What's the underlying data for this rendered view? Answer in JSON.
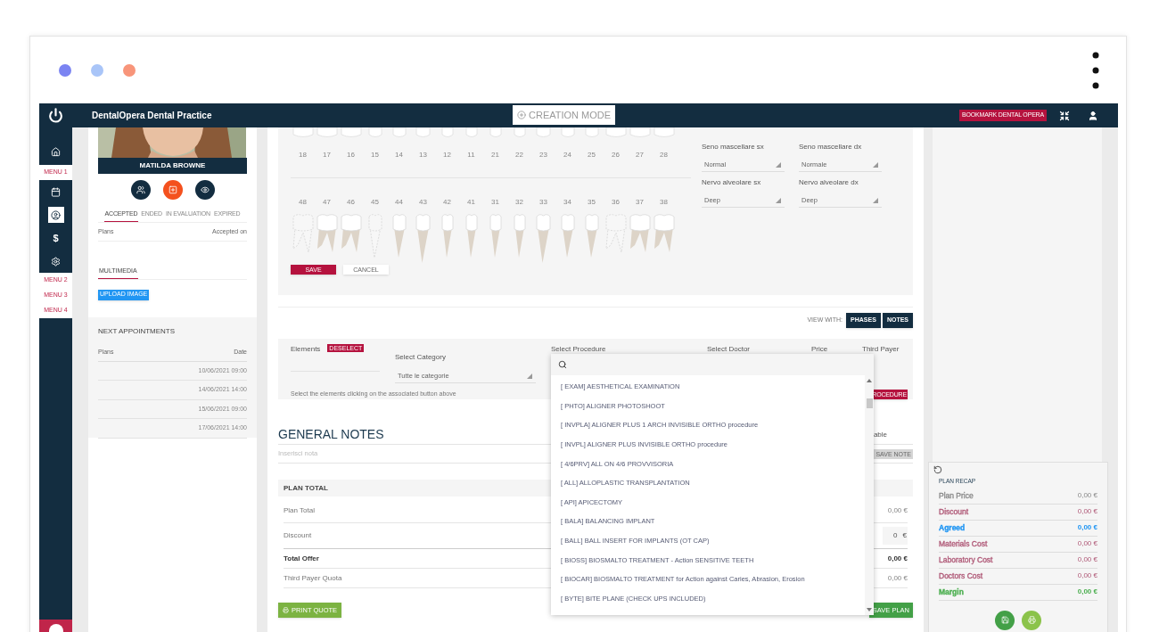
{
  "header": {
    "title": "DentalOpera Dental Practice",
    "mode": "CREATION MODE",
    "bookmark": "BOOKMARK DENTAL OPERA"
  },
  "sidebar": {
    "items": [
      {
        "kind": "icon",
        "selected": false
      },
      {
        "kind": "menu",
        "label": "MENU 1"
      },
      {
        "kind": "icon",
        "selected": false
      },
      {
        "kind": "icon",
        "selected": true
      },
      {
        "kind": "symbol",
        "label": "$",
        "selected": false
      },
      {
        "kind": "icon",
        "selected": false
      },
      {
        "kind": "menu",
        "label": "MENU 2"
      },
      {
        "kind": "menu",
        "label": "MENU 3"
      },
      {
        "kind": "menu",
        "label": "MENU 4"
      }
    ]
  },
  "patient": {
    "name": "MATILDA BROWNE",
    "plan_tabs": [
      {
        "label": "ACCEPTED",
        "selected": true
      },
      {
        "label": "ENDED",
        "selected": false
      },
      {
        "label": "IN EVALUATION",
        "selected": false
      },
      {
        "label": "EXPIRED",
        "selected": false
      }
    ],
    "plan_columns": [
      "Plans",
      "Accepted on"
    ],
    "media_tabs": [
      {
        "label": "MULTIMEDIA",
        "selected": true
      }
    ],
    "upload_button": "UPLOAD IMAGE"
  },
  "appointments": {
    "title": "NEXT APPOINTMENTS",
    "columns": [
      "Plans",
      "Date"
    ],
    "rows": [
      "10/06/2021 09:00",
      "14/06/2021 14:00",
      "15/06/2021 09:00",
      "17/06/2021 14:00"
    ]
  },
  "odontogram": {
    "upper": [
      {
        "number": "18"
      },
      {
        "number": "17"
      },
      {
        "number": "16"
      },
      {
        "number": "15"
      },
      {
        "number": "14"
      },
      {
        "number": "13"
      },
      {
        "number": "12"
      },
      {
        "number": "11"
      },
      {
        "number": "21"
      },
      {
        "number": "22"
      },
      {
        "number": "23"
      },
      {
        "number": "24"
      },
      {
        "number": "25"
      },
      {
        "number": "26"
      },
      {
        "number": "27"
      },
      {
        "number": "28"
      }
    ],
    "lower": [
      {
        "number": "48",
        "present": false
      },
      {
        "number": "47",
        "present": true
      },
      {
        "number": "46",
        "present": true
      },
      {
        "number": "45",
        "present": false
      },
      {
        "number": "44",
        "present": true
      },
      {
        "number": "43",
        "present": true
      },
      {
        "number": "42",
        "present": true
      },
      {
        "number": "41",
        "present": true
      },
      {
        "number": "31",
        "present": true
      },
      {
        "number": "32",
        "present": true
      },
      {
        "number": "33",
        "present": true
      },
      {
        "number": "34",
        "present": true
      },
      {
        "number": "35",
        "present": true
      },
      {
        "number": "36",
        "present": false
      },
      {
        "number": "37",
        "present": true
      },
      {
        "number": "38",
        "present": true
      }
    ],
    "fields": [
      {
        "label": "Seno mascellare sx",
        "value": "Normal"
      },
      {
        "label": "Seno mascellare dx",
        "value": "Normale"
      },
      {
        "label": "Nervo alveolare sx",
        "value": "Deep"
      },
      {
        "label": "Nervo alveolare dx",
        "value": "Deep"
      }
    ],
    "save": "SAVE",
    "cancel": "CANCEL"
  },
  "view_with": {
    "label": "VIEW WITH:",
    "buttons": [
      "PHASES",
      "NOTES"
    ]
  },
  "procedure_form": {
    "elements": "Elements",
    "deselect": "DESELECT",
    "category_label": "Select Category",
    "category_value": "Tutte le categorie",
    "procedure_label": "Select Procedure",
    "doctor_label": "Select Doctor",
    "price_label": "Price",
    "third_payer_label": "Third Payer",
    "hint": "Select the elements clicking on the associated button above",
    "add_button": "ROCEDURE"
  },
  "procedure_dropdown": {
    "items": [
      "[ EXAM] AESTHETICAL EXAMINATION",
      "[ PHTO] ALIGNER PHOTOSHOOT",
      "[ INVPLA] ALIGNER PLUS 1 ARCH INVISIBLE ORTHO procedure",
      "[ INVPL] ALIGNER PLUS INVISIBLE ORTHO procedure",
      "[ 4/6PRV] ALL ON 4/6 PROVVISORIA",
      "[ ALL] ALLOPLASTIC TRANSPLANTATION",
      "[ API] APICECTOMY",
      "[ BALA] BALANCING IMPLANT",
      "[ BALL] BALL INSERT FOR IMPLANTS (OT CAP)",
      "[ BIOSS] BIOSMALTO TREATMENT - Action SENSITIVE TEETH",
      "[ BIOCAR] BIOSMALTO TREATMENT for Action against Caries, Abrasion, Erosion",
      "[ BYTE] BITE PLANE (CHECK UPS INCLUDED)"
    ]
  },
  "notes": {
    "title": "GENERAL NOTES",
    "side_text": "able",
    "placeholder": "Inserisci nota",
    "save_note": "SAVE NOTE",
    "save_note_disabled": true
  },
  "plan_total": {
    "title": "PLAN TOTAL",
    "rows": [
      {
        "kind": "text",
        "label": "Plan Total",
        "value": "0,00 €"
      },
      {
        "kind": "input",
        "label": "Discount",
        "value": "0",
        "unit": "€"
      },
      {
        "kind": "bold",
        "label": "Total Offer",
        "value": "0,00 €"
      },
      {
        "kind": "text",
        "label": "Third Payer Quota",
        "value": "0,00 €"
      }
    ],
    "print": "PRINT QUOTE",
    "save": "SAVE PLAN"
  },
  "recap": {
    "title": "PLAN RECAP",
    "rows": [
      {
        "label": "Plan Price",
        "value": "0,00 €",
        "color": "#8a8a8a",
        "bold": false
      },
      {
        "label": "Discount",
        "value": "0,00 €",
        "color": "#b05a78",
        "bold": false
      },
      {
        "label": "Agreed",
        "value": "0,00 €",
        "color": "#2196f3",
        "bold": true
      },
      {
        "label": "Materials Cost",
        "value": "0,00 €",
        "color": "#b05a78",
        "bold": false
      },
      {
        "label": "Laboratory Cost",
        "value": "0,00 €",
        "color": "#b05a78",
        "bold": false
      },
      {
        "label": "Doctors Cost",
        "value": "0,00 €",
        "color": "#b05a78",
        "bold": false
      },
      {
        "label": "Margin",
        "value": "0,00 €",
        "color": "#4caf50",
        "bold": true
      }
    ]
  }
}
